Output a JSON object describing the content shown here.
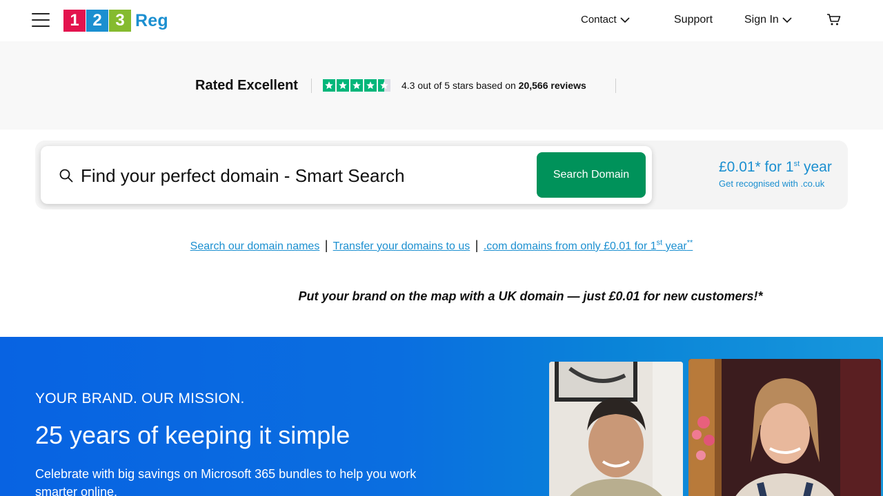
{
  "header": {
    "logo": {
      "digits": [
        "1",
        "2",
        "3"
      ],
      "word": "Reg"
    },
    "nav": {
      "contact": "Contact",
      "support": "Support",
      "sign_in": "Sign In"
    },
    "icons": [
      "menu-icon",
      "chevron-down-icon",
      "cart-icon"
    ]
  },
  "trust": {
    "rated": "Rated Excellent",
    "rating_prefix": "4.3 out of 5 stars based on ",
    "reviews": "20,566 reviews",
    "stars": 4.5
  },
  "search": {
    "placeholder": "Find your perfect domain - Smart Search",
    "button": "Search Domain",
    "promo_price": "£0.01* for 1",
    "promo_sup": "st",
    "promo_year": " year",
    "promo_sub": "Get recognised with .co.uk"
  },
  "links": {
    "search_names": "Search our domain names",
    "transfer": "Transfer your domains to us",
    "com_prefix": ".com domains from only £0.01 for 1",
    "com_sup": "st",
    "com_suffix": " year",
    "com_sup2": "**",
    "separator": "|"
  },
  "tagline": "Put your brand on the map with a UK domain — just £0.01 for new customers!*",
  "hero": {
    "eyebrow": "YOUR BRAND. OUR MISSION.",
    "title": "25 years of keeping it simple",
    "text": "Celebrate with big savings on Microsoft 365 bundles to help you work smarter online."
  },
  "colors": {
    "brand_blue": "#1b8fd0",
    "logo_red": "#e3134e",
    "logo_green": "#85bb2f",
    "search_button": "#00925a",
    "trustpilot_green": "#00b67a",
    "hero_blue": "#0863e2"
  }
}
